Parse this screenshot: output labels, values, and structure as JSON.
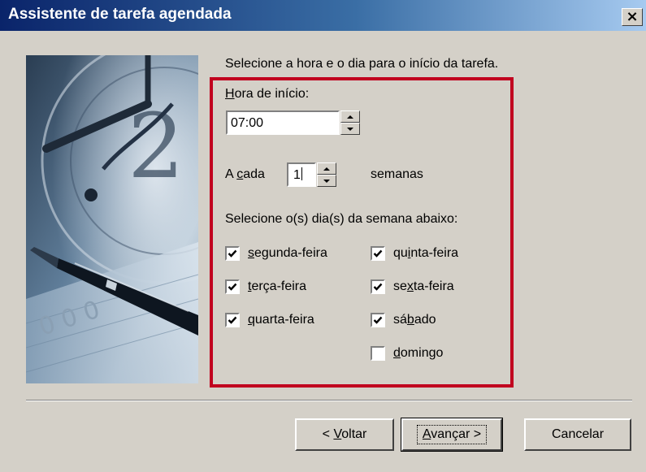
{
  "window": {
    "title": "Assistente de tarefa agendada",
    "close_label": "×"
  },
  "main": {
    "instruction": "Selecione a hora e o dia para o início da tarefa.",
    "start_time": {
      "label_accel": "H",
      "label_rest": "ora de início:",
      "value": "07:00"
    },
    "every": {
      "label_pre": "A ",
      "label_accel": "c",
      "label_post": "ada",
      "value": "1",
      "unit": "semanas"
    },
    "days_prompt": "Selecione o(s) dia(s) da semana abaixo:",
    "days": [
      {
        "pre": "",
        "accel": "s",
        "post": "egunda-feira",
        "checked": true
      },
      {
        "pre": "",
        "accel": "t",
        "post": "erça-feira",
        "checked": true
      },
      {
        "pre": "",
        "accel": "q",
        "post": "uarta-feira",
        "checked": true
      },
      {
        "pre": "qu",
        "accel": "i",
        "post": "nta-feira",
        "checked": true
      },
      {
        "pre": "se",
        "accel": "x",
        "post": "ta-feira",
        "checked": true
      },
      {
        "pre": "sá",
        "accel": "b",
        "post": "ado",
        "checked": true
      },
      {
        "pre": "",
        "accel": "d",
        "post": "omingo",
        "checked": false
      }
    ]
  },
  "buttons": {
    "back": {
      "pre": "< ",
      "accel": "V",
      "post": "oltar"
    },
    "next": {
      "pre": "",
      "accel": "A",
      "post": "vançar >"
    },
    "cancel": "Cancelar"
  },
  "colors": {
    "dialog_bg": "#d4d0c8",
    "title_start": "#0a246a",
    "title_end": "#a6caf0",
    "highlight_border": "#c1001f"
  }
}
